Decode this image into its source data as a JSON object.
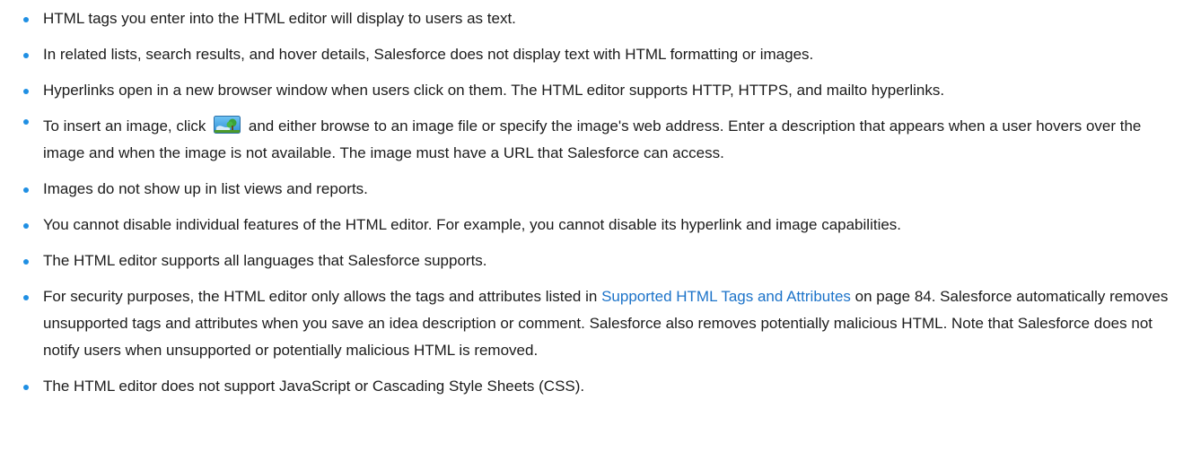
{
  "bullets": [
    {
      "text": "HTML tags you enter into the HTML editor will display to users as text."
    },
    {
      "text": "In related lists, search results, and hover details, Salesforce does not display text with HTML formatting or images."
    },
    {
      "text": "Hyperlinks open in a new browser window when users click on them. The HTML editor supports HTTP, HTTPS, and mailto hyperlinks."
    },
    {
      "before_icon": "To insert an image, click",
      "icon": "insert-image-icon",
      "after_icon": "and either browse to an image file or specify the image's web address. Enter a description that appears when a user hovers over the image and when the image is not available. The image must have a URL that Salesforce can access."
    },
    {
      "text": "Images do not show up in list views and reports."
    },
    {
      "text": "You cannot disable individual features of the HTML editor. For example, you cannot disable its hyperlink and image capabilities."
    },
    {
      "text": "The HTML editor supports all languages that Salesforce supports."
    },
    {
      "before_link": "For security purposes, the HTML editor only allows the tags and attributes listed in",
      "link": "Supported HTML Tags and Attributes",
      "after_link": "on page 84. Salesforce automatically removes unsupported tags and attributes when you save an idea description or comment. Salesforce also removes potentially malicious HTML. Note that Salesforce does not notify users when unsupported or potentially malicious HTML is removed."
    },
    {
      "text": "The HTML editor does not support JavaScript or Cascading Style Sheets (CSS)."
    }
  ],
  "colors": {
    "bullet": "#1f8fe3",
    "link": "#1c73c9",
    "text": "#1b1b1b"
  }
}
